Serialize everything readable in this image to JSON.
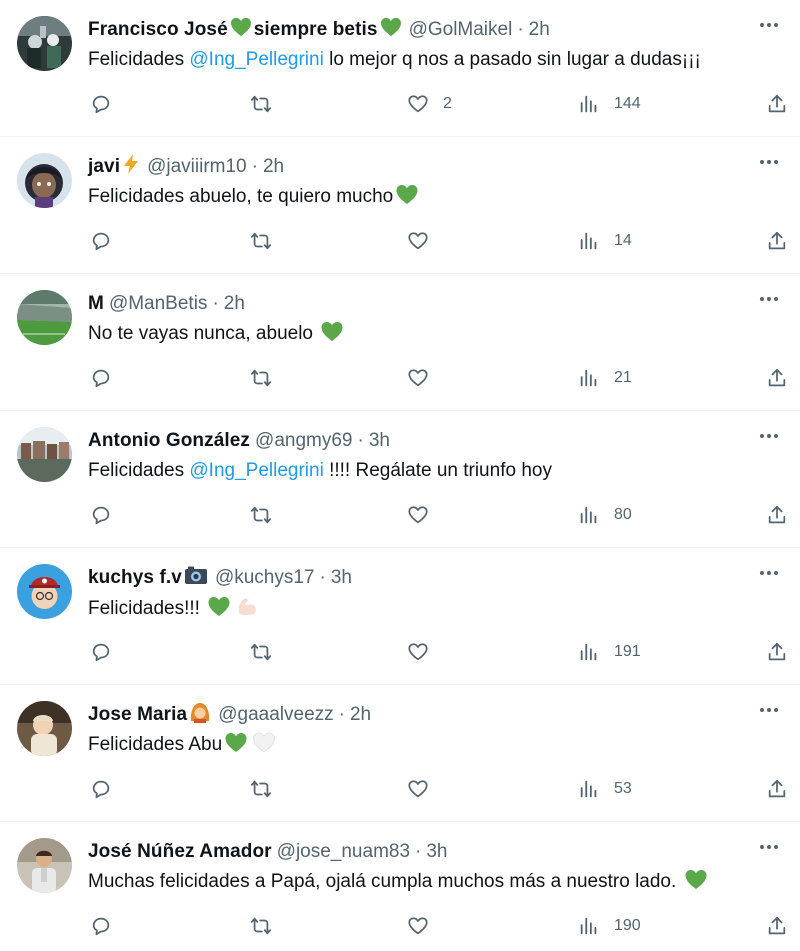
{
  "colors": {
    "accent": "#1d9bf0",
    "secondary_text": "#536471",
    "heart_green": "#5aa84a"
  },
  "tweets": [
    {
      "name": "Francisco José",
      "name_suffix": "siempre betis",
      "handle": "@GolMaikel",
      "sep": "·",
      "time": "2h",
      "text_before": "Felicidades ",
      "mention": "@Ing_Pellegrini",
      "text_after": " lo mejor q nos a pasado sin lugar a dudas¡¡¡",
      "likes": "2",
      "views": "144"
    },
    {
      "name": "javi",
      "handle": "@javiiirm10",
      "sep": "·",
      "time": "2h",
      "text": "Felicidades abuelo, te quiero mucho",
      "likes": "",
      "views": "14"
    },
    {
      "name": "M",
      "handle": "@ManBetis",
      "sep": "·",
      "time": "2h",
      "text": "No te vayas nunca, abuelo ",
      "likes": "",
      "views": "21"
    },
    {
      "name": "Antonio González",
      "handle": "@angmy69",
      "sep": "·",
      "time": "3h",
      "text_before": "Felicidades ",
      "mention": "@Ing_Pellegrini",
      "text_after": " !!!! Regálate un triunfo hoy",
      "likes": "",
      "views": "80"
    },
    {
      "name": "kuchys f.v",
      "handle": "@kuchys17",
      "sep": "·",
      "time": "3h",
      "text": "Felicidades!!! ",
      "likes": "",
      "views": "191"
    },
    {
      "name": "Jose Maria",
      "handle": "@gaaalveezz",
      "sep": "·",
      "time": "2h",
      "text": "Felicidades Abu",
      "likes": "",
      "views": "53"
    },
    {
      "name": "José Núñez Amador",
      "handle": "@jose_nuam83",
      "sep": "·",
      "time": "3h",
      "text": "Muchas felicidades a Papá, ojalá cumpla muchos más a nuestro lado. ",
      "likes": "",
      "views": "190"
    }
  ]
}
